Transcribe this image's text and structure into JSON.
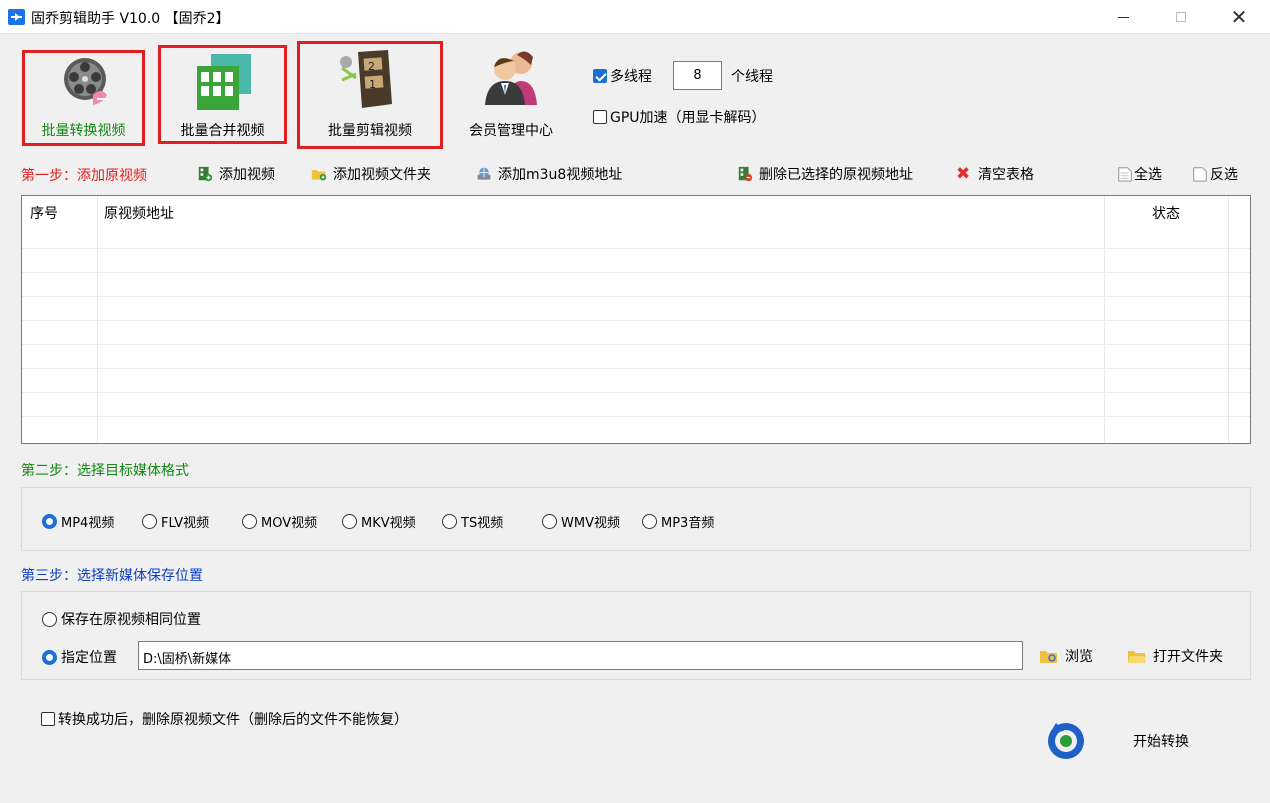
{
  "window": {
    "title": "固乔剪辑助手 V10.0 【固乔2】"
  },
  "modes": [
    {
      "label": "批量转换视频",
      "active": true
    },
    {
      "label": "批量合并视频",
      "active": true
    },
    {
      "label": "批量剪辑视频",
      "active": true
    },
    {
      "label": "会员管理中心",
      "active": false
    }
  ],
  "threads": {
    "multithread_label": "多线程",
    "multithread_checked": true,
    "count": "8",
    "count_suffix": "个线程",
    "gpu_label": "GPU加速（用显卡解码）",
    "gpu_checked": false
  },
  "step1": {
    "label": "第一步：添加原视频",
    "add_video": "添加视频",
    "add_folder": "添加视频文件夹",
    "add_m3u8": "添加m3u8视频地址",
    "delete_selected": "删除已选择的原视频地址",
    "clear_table": "清空表格",
    "select_all": "全选",
    "invert": "反选"
  },
  "table": {
    "columns": [
      "序号",
      "原视频地址",
      "状态"
    ],
    "rows": []
  },
  "step2": {
    "label": "第二步：选择目标媒体格式",
    "formats": [
      {
        "label": "MP4视频",
        "selected": true
      },
      {
        "label": "FLV视频",
        "selected": false
      },
      {
        "label": "MOV视频",
        "selected": false
      },
      {
        "label": "MKV视频",
        "selected": false
      },
      {
        "label": "TS视频",
        "selected": false
      },
      {
        "label": "WMV视频",
        "selected": false
      },
      {
        "label": "MP3音频",
        "selected": false
      }
    ]
  },
  "step3": {
    "label": "第三步：选择新媒体保存位置",
    "same_location": "保存在原视频相同位置",
    "custom_location": "指定位置",
    "path": "D:\\固桥\\新媒体",
    "browse": "浏览",
    "open_folder": "打开文件夹"
  },
  "footer": {
    "delete_after": "转换成功后，删除原视频文件（删除后的文件不能恢复）",
    "start": "开始转换"
  },
  "colors": {
    "active_border": "#e02020",
    "step1": "#e02020",
    "step2": "#118811",
    "step3": "#1040c0",
    "accent": "#1c6fd6"
  }
}
